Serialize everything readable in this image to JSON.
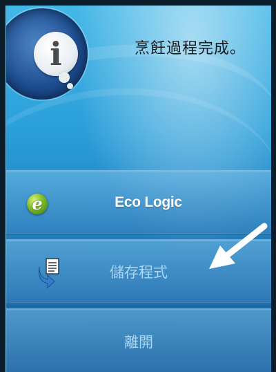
{
  "dialog": {
    "message": "烹飪過程完成。"
  },
  "menu": {
    "eco_label": "Eco Logic",
    "save_label": "儲存程式",
    "exit_label": "離開"
  },
  "icons": {
    "info": "info-bubble-icon",
    "eco": "eco-logic-icon",
    "save": "save-program-icon",
    "pointer": "pointer-arrow"
  },
  "colors": {
    "background_top": "#43b7e7",
    "background_bottom": "#155b96",
    "button_text": "#ffffff",
    "button_text_dim": "#a9d6f3"
  }
}
